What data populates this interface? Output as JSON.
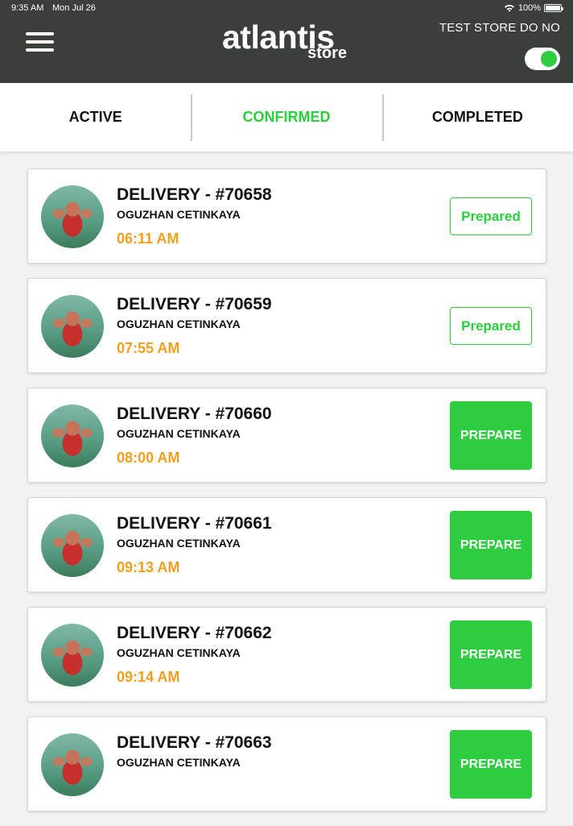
{
  "status_bar": {
    "time": "9:35 AM",
    "date": "Mon Jul 26",
    "battery": "100%"
  },
  "header": {
    "logo_main": "atlantis",
    "logo_sub": "store",
    "store_name": "TEST STORE DO NO",
    "toggle_on": true,
    "accent": "#2ecc40",
    "bg": "#3a3f3c"
  },
  "tabs": [
    {
      "label": "ACTIVE"
    },
    {
      "label": "CONFIRMED"
    },
    {
      "label": "COMPLETED"
    }
  ],
  "orders": [
    {
      "title": "DELIVERY - #70658",
      "name": "OGUZHAN CETINKAYA",
      "time": "06:11 AM",
      "action": "Prepared"
    },
    {
      "title": "DELIVERY - #70659",
      "name": "OGUZHAN CETINKAYA",
      "time": "07:55 AM",
      "action": "Prepared"
    },
    {
      "title": "DELIVERY - #70660",
      "name": "OGUZHAN CETINKAYA",
      "time": "08:00 AM",
      "action": "PREPARE"
    },
    {
      "title": "DELIVERY - #70661",
      "name": "OGUZHAN CETINKAYA",
      "time": "09:13 AM",
      "action": "PREPARE"
    },
    {
      "title": "DELIVERY - #70662",
      "name": "OGUZHAN CETINKAYA",
      "time": "09:14 AM",
      "action": "PREPARE"
    },
    {
      "title": "DELIVERY - #70663",
      "name": "OGUZHAN CETINKAYA",
      "time": "",
      "action": "PREPARE"
    }
  ],
  "colors": {
    "time": "#f0a020",
    "prepare_bg": "#2ecc40"
  }
}
